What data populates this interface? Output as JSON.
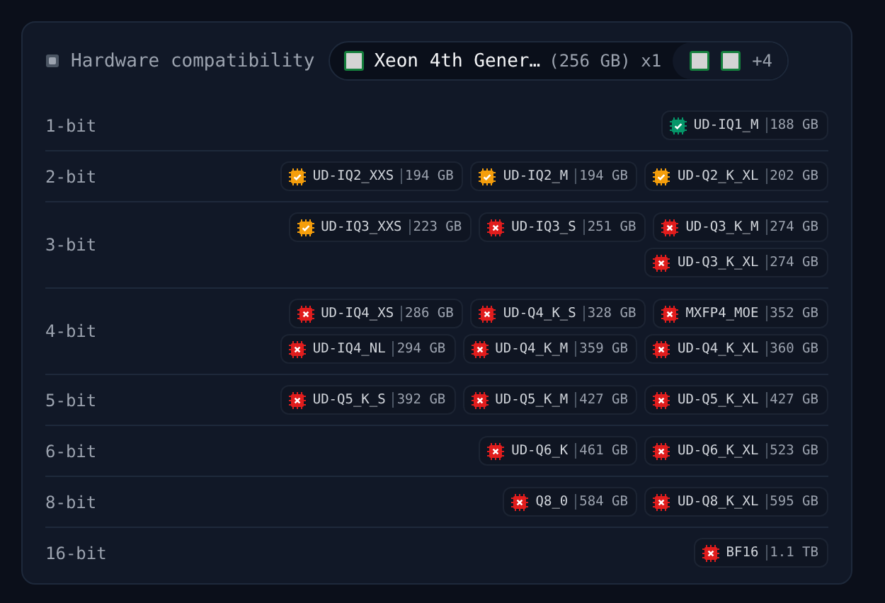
{
  "header": {
    "title": "Hardware compatibility",
    "device": {
      "name": "Xeon 4th Gener…",
      "detail": "(256 GB) x1"
    },
    "extra_count": "+4"
  },
  "rows": [
    {
      "label": "1-bit",
      "quants": [
        {
          "name": "UD-IQ1_M",
          "size": "188 GB",
          "kind": "ok"
        }
      ]
    },
    {
      "label": "2-bit",
      "quants": [
        {
          "name": "UD-IQ2_XXS",
          "size": "194 GB",
          "kind": "warn"
        },
        {
          "name": "UD-IQ2_M",
          "size": "194 GB",
          "kind": "warn"
        },
        {
          "name": "UD-Q2_K_XL",
          "size": "202 GB",
          "kind": "warn"
        }
      ]
    },
    {
      "label": "3-bit",
      "quants": [
        {
          "name": "UD-IQ3_XXS",
          "size": "223 GB",
          "kind": "warn"
        },
        {
          "name": "UD-IQ3_S",
          "size": "251 GB",
          "kind": "fail"
        },
        {
          "name": "UD-Q3_K_M",
          "size": "274 GB",
          "kind": "fail"
        },
        {
          "name": "UD-Q3_K_XL",
          "size": "274 GB",
          "kind": "fail"
        }
      ]
    },
    {
      "label": "4-bit",
      "quants": [
        {
          "name": "UD-IQ4_XS",
          "size": "286 GB",
          "kind": "fail"
        },
        {
          "name": "UD-Q4_K_S",
          "size": "328 GB",
          "kind": "fail"
        },
        {
          "name": "MXFP4_MOE",
          "size": "352 GB",
          "kind": "fail"
        },
        {
          "name": "UD-IQ4_NL",
          "size": "294 GB",
          "kind": "fail"
        },
        {
          "name": "UD-Q4_K_M",
          "size": "359 GB",
          "kind": "fail"
        },
        {
          "name": "UD-Q4_K_XL",
          "size": "360 GB",
          "kind": "fail"
        }
      ]
    },
    {
      "label": "5-bit",
      "quants": [
        {
          "name": "UD-Q5_K_S",
          "size": "392 GB",
          "kind": "fail"
        },
        {
          "name": "UD-Q5_K_M",
          "size": "427 GB",
          "kind": "fail"
        },
        {
          "name": "UD-Q5_K_XL",
          "size": "427 GB",
          "kind": "fail"
        }
      ]
    },
    {
      "label": "6-bit",
      "quants": [
        {
          "name": "UD-Q6_K",
          "size": "461 GB",
          "kind": "fail"
        },
        {
          "name": "UD-Q6_K_XL",
          "size": "523 GB",
          "kind": "fail"
        }
      ]
    },
    {
      "label": "8-bit",
      "quants": [
        {
          "name": "Q8_0",
          "size": "584 GB",
          "kind": "fail"
        },
        {
          "name": "UD-Q8_K_XL",
          "size": "595 GB",
          "kind": "fail"
        }
      ]
    },
    {
      "label": "16-bit",
      "quants": [
        {
          "name": "BF16",
          "size": "1.1 TB",
          "kind": "fail"
        }
      ]
    }
  ]
}
